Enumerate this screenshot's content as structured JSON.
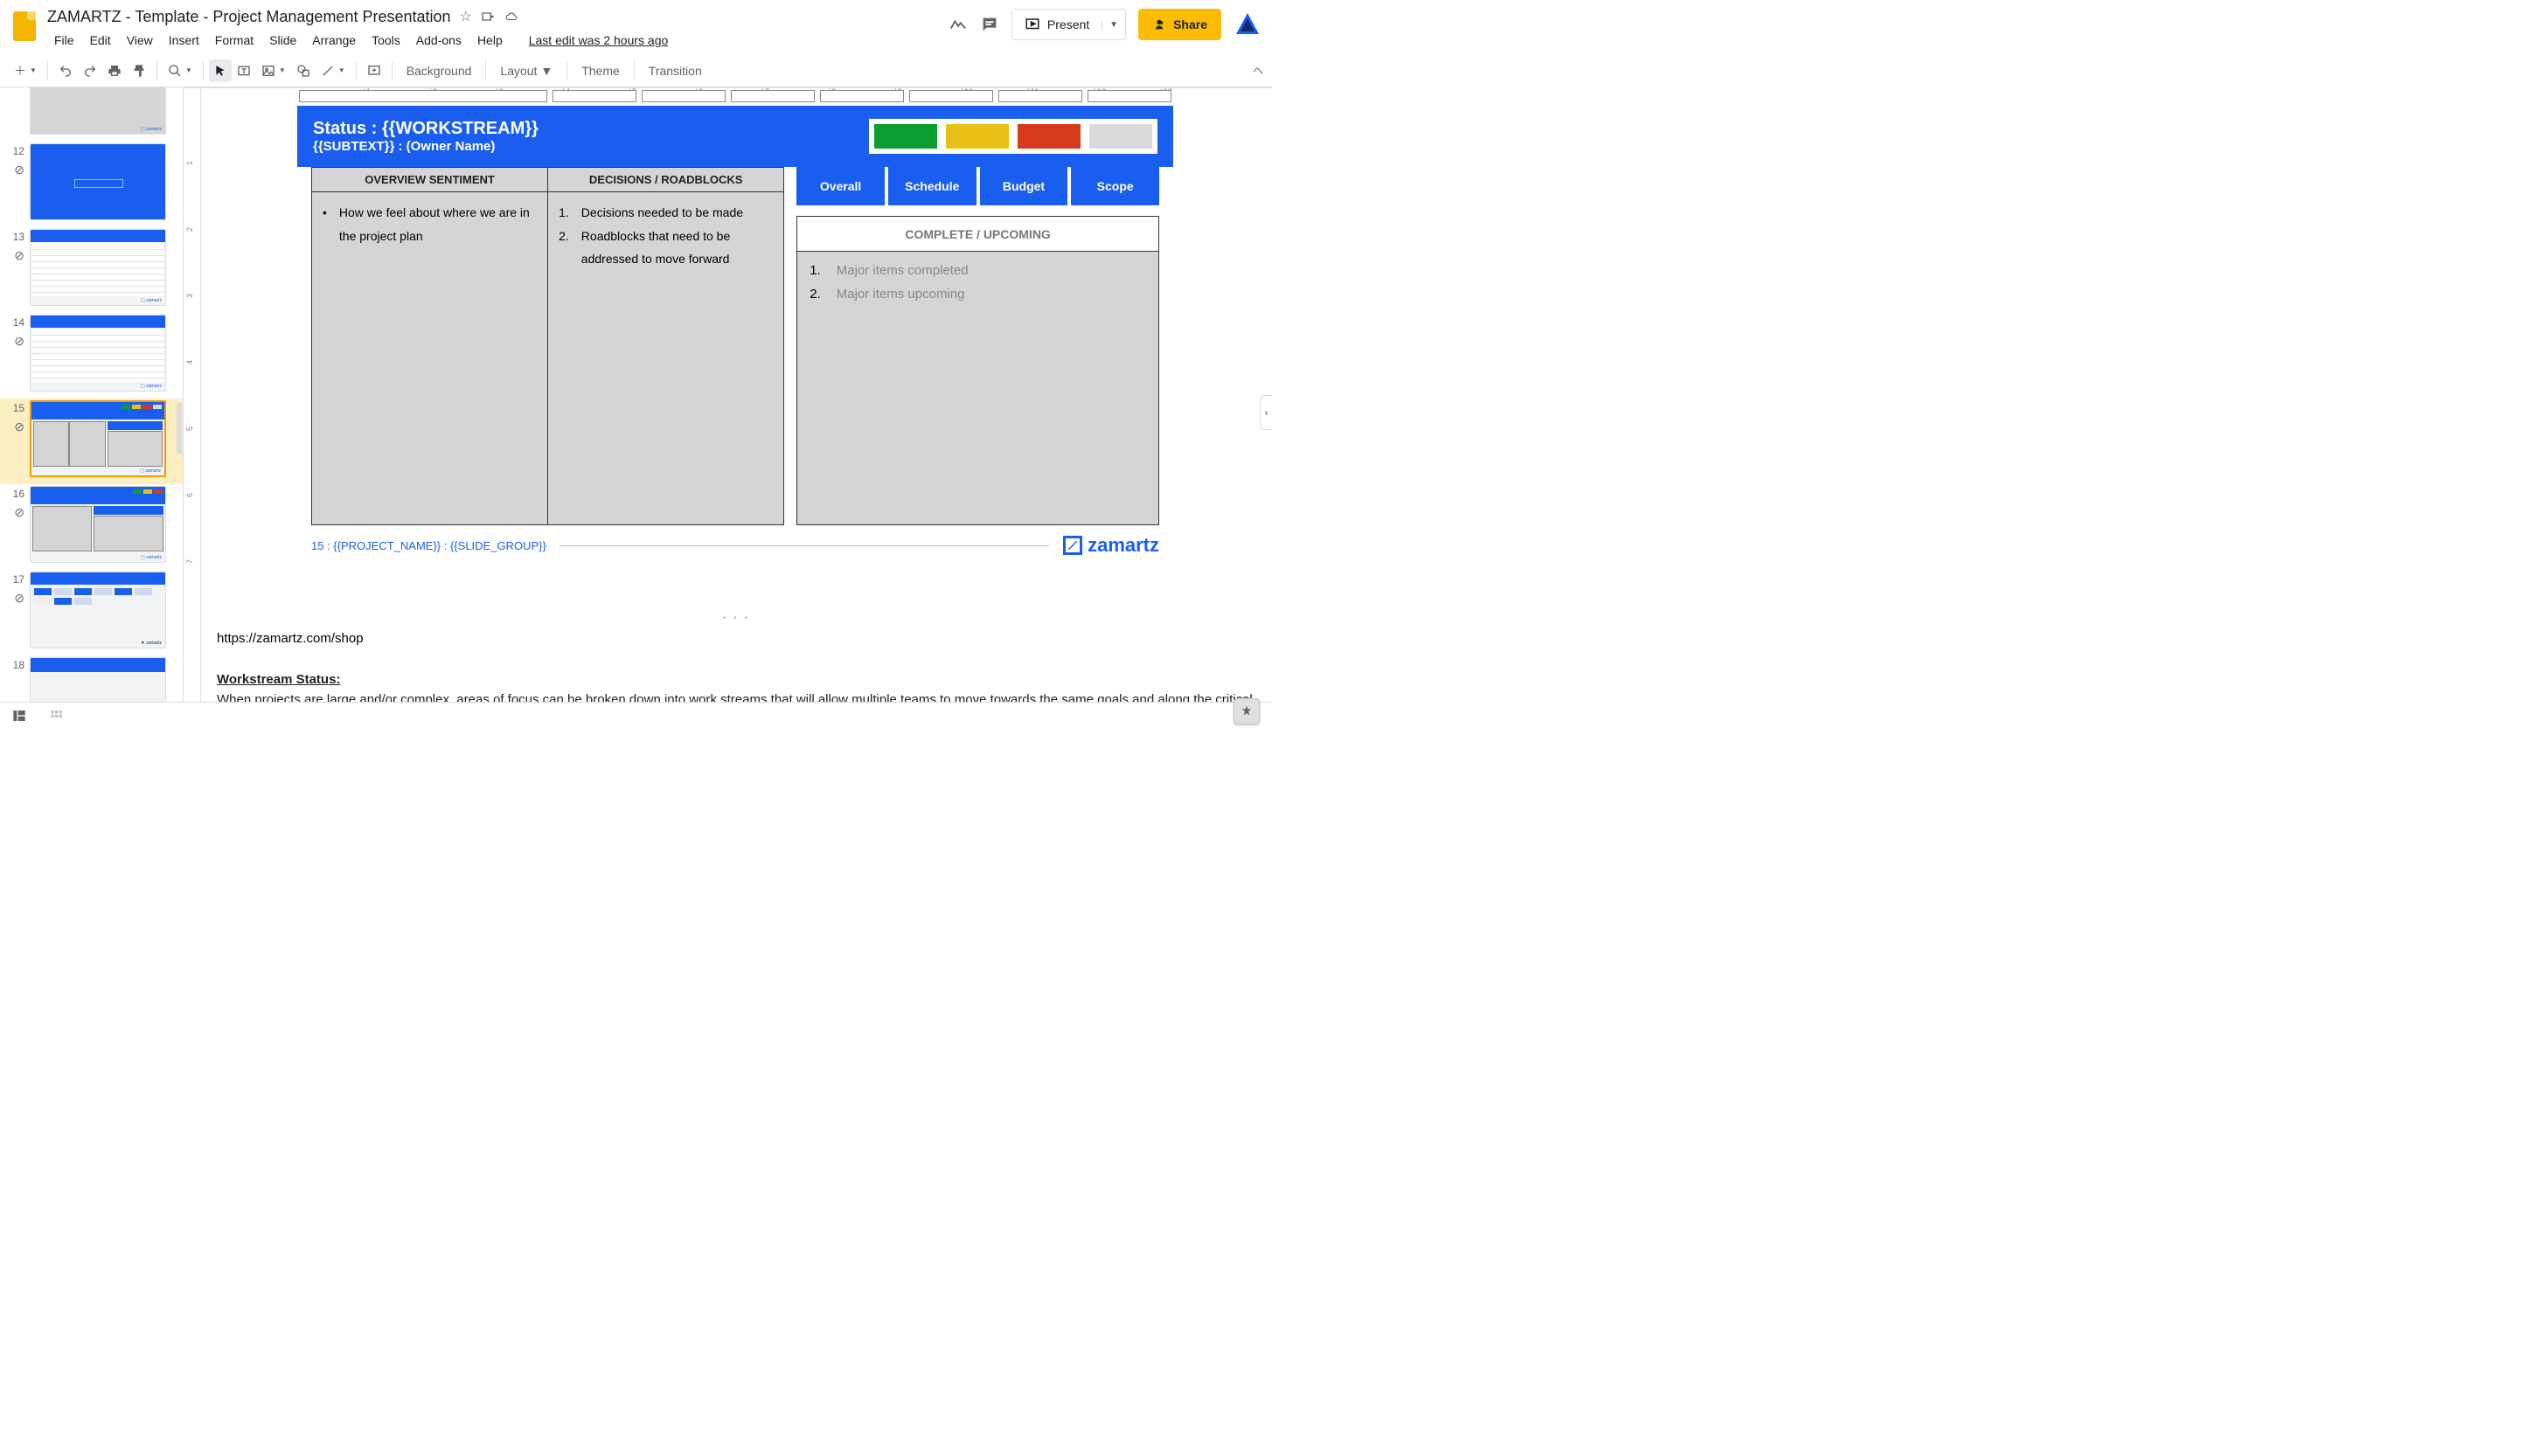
{
  "doc": {
    "title": "ZAMARTZ - Template - Project Management Presentation",
    "last_edit": "Last edit was 2 hours ago"
  },
  "menus": [
    "File",
    "Edit",
    "View",
    "Insert",
    "Format",
    "Slide",
    "Arrange",
    "Tools",
    "Add-ons",
    "Help"
  ],
  "header_buttons": {
    "present": "Present",
    "share": "Share"
  },
  "toolbar_text": {
    "background": "Background",
    "layout": "Layout",
    "theme": "Theme",
    "transition": "Transition"
  },
  "ruler_h": [
    "1",
    "2",
    "3",
    "4",
    "5",
    "6",
    "7",
    "8",
    "9",
    "10",
    "11",
    "12",
    "13"
  ],
  "ruler_v": [
    "1",
    "2",
    "3",
    "4",
    "5",
    "6",
    "7"
  ],
  "thumbs": [
    {
      "n": "",
      "label": ""
    },
    {
      "n": "12",
      "label": ""
    },
    {
      "n": "13",
      "label": ""
    },
    {
      "n": "14",
      "label": ""
    },
    {
      "n": "15",
      "label": "",
      "current": true
    },
    {
      "n": "16",
      "label": ""
    },
    {
      "n": "17",
      "label": ""
    },
    {
      "n": "18",
      "label": ""
    }
  ],
  "slide": {
    "title": "Status : {{WORKSTREAM}}",
    "subtitle": "{{SUBTEXT}} : (Owner Name)",
    "chips": [
      {
        "color": "#0b9d2d"
      },
      {
        "color": "#e8c016"
      },
      {
        "color": "#d63a1a"
      },
      {
        "color": "#d9d9d9"
      }
    ],
    "left_cols": {
      "overview_h": "OVERVIEW SENTIMENT",
      "decisions_h": "DECISIONS / ROADBLOCKS",
      "overview_body": "How we feel about where we are in the project plan",
      "decisions_1": "Decisions needed to be made",
      "decisions_2": "Roadblocks that need to be addressed to move forward"
    },
    "status_labels": [
      "Overall",
      "Schedule",
      "Budget",
      "Scope"
    ],
    "cu": {
      "header": "COMPLETE / UPCOMING",
      "item1": "Major items completed",
      "item2": "Major items upcoming"
    },
    "footer_left": "15 : {{PROJECT_NAME}} : {{SLIDE_GROUP}}",
    "logo_text": "zamartz"
  },
  "notes": {
    "url": "https://zamartz.com/shop",
    "heading": "Workstream Status:",
    "body": "When projects are large and/or complex, areas of focus can be broken down into work streams that will allow multiple teams to move towards the same goals and along the critical path."
  }
}
